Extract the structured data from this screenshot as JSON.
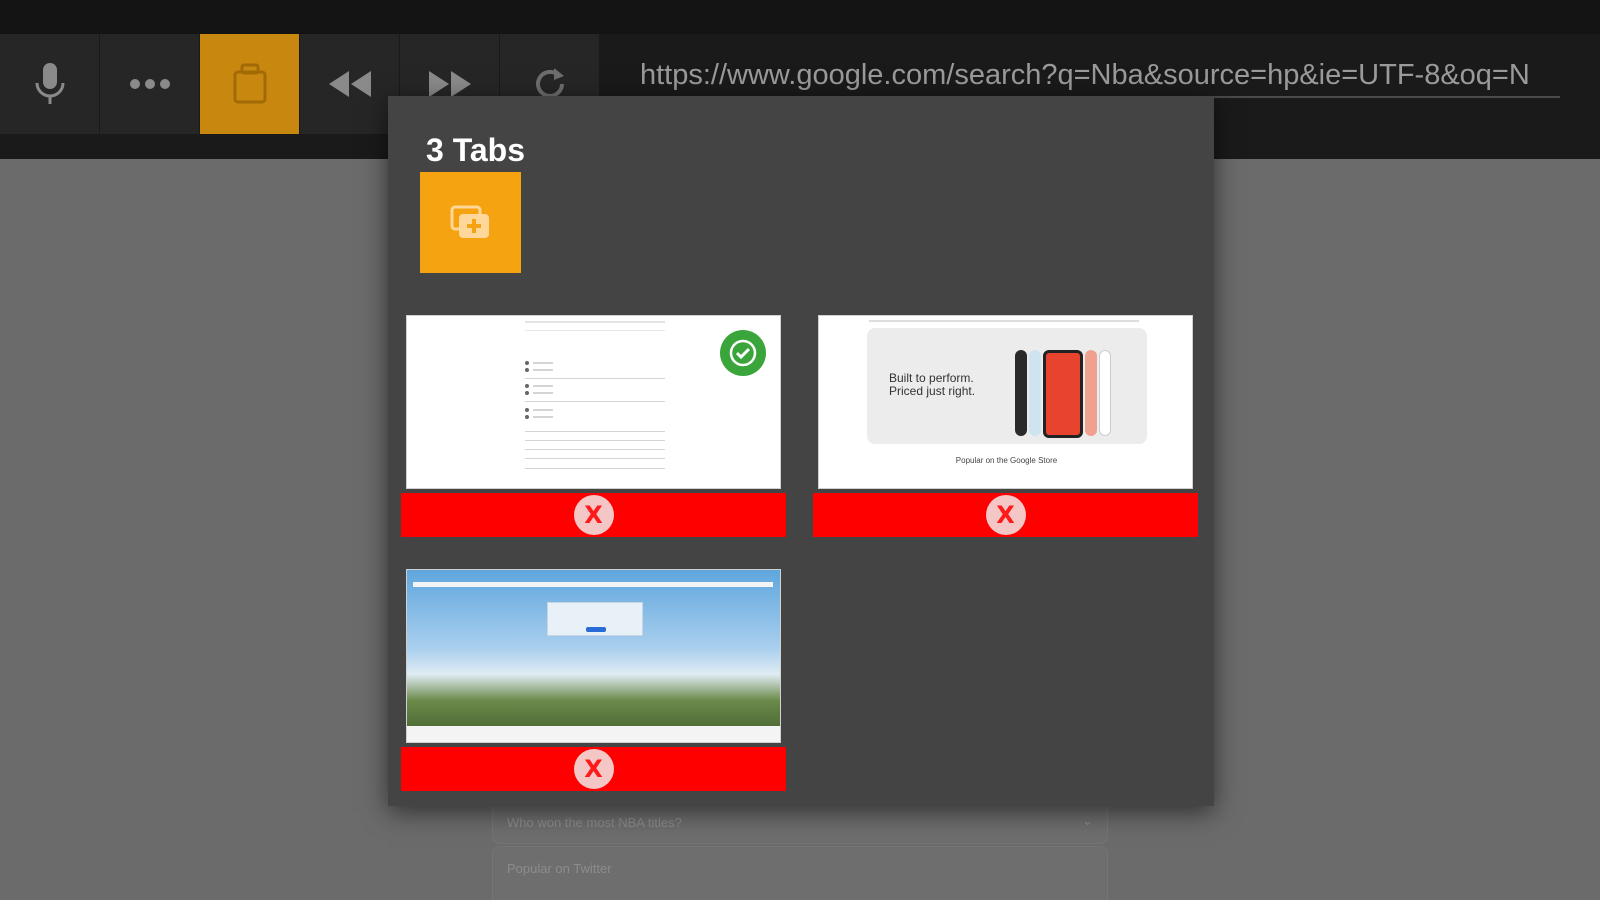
{
  "toolbar": {
    "buttons": [
      {
        "name": "microphone-icon"
      },
      {
        "name": "more-dots-icon"
      },
      {
        "name": "tabs-icon"
      },
      {
        "name": "rewind-icon"
      },
      {
        "name": "fast-forward-icon"
      },
      {
        "name": "reload-icon"
      }
    ],
    "url": "https://www.google.com/search?q=Nba&source=hp&ie=UTF-8&oq=N",
    "active_color": "#c8870e"
  },
  "background_page": {
    "question": "Who won the most NBA titles?",
    "section": "Popular on Twitter"
  },
  "tab_switcher": {
    "title": "3 Tabs",
    "new_tab_color": "#f5a311",
    "close_color": "#ff0000",
    "close_glyph": "X",
    "tabs": [
      {
        "kind": "google-search",
        "selected": true
      },
      {
        "kind": "google-store",
        "headline": "Built to perform. Priced just right.",
        "subhead": "Popular on the Google Store"
      },
      {
        "kind": "desktop-wallpaper"
      }
    ]
  }
}
